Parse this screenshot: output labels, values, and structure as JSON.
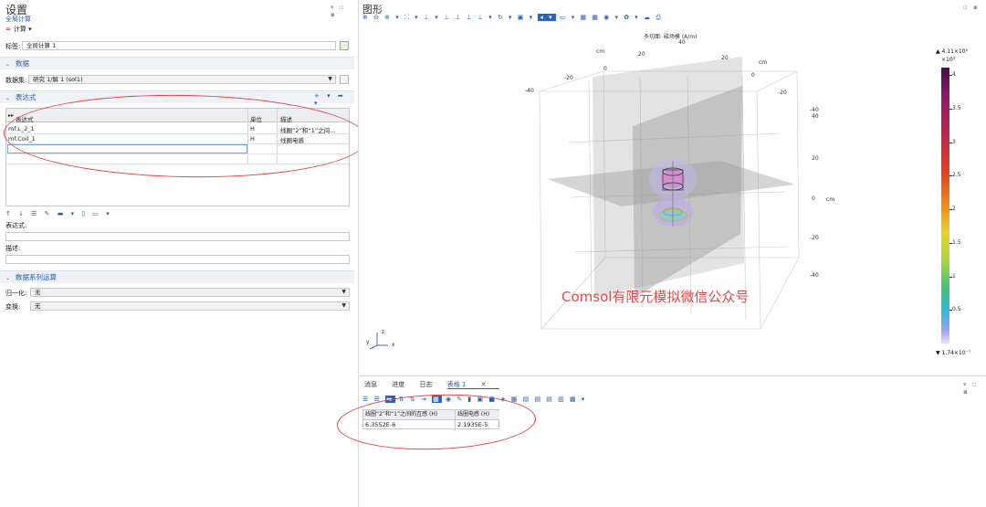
{
  "settings": {
    "title": "设置",
    "subtitle": "全局计算",
    "compute_label": "计算",
    "label_row": {
      "label": "标签:",
      "value": "全局计算 1"
    },
    "data_section": "数据",
    "dataset_row": {
      "label": "数据集:",
      "value": "研究 1/解 1 (sol1)"
    },
    "expr_section": "表达式",
    "table_headers": [
      "表达式",
      "单位",
      "描述"
    ],
    "table_rows": [
      {
        "expr": "mf.L_2_1",
        "unit": "H",
        "desc": "线圈“2”和“1”之间..."
      },
      {
        "expr": "mf.Coil_1",
        "unit": "H",
        "desc": "线圈电感"
      }
    ],
    "expression_label": "表达式:",
    "description_label": "描述:",
    "series_section": "数据系列运算",
    "normalize_row": {
      "label": "归一化:",
      "value": "无"
    },
    "transform_row": {
      "label": "变换:",
      "value": "无"
    }
  },
  "graphics": {
    "title": "图形",
    "plot_title": "多切面: 磁场模 (A/m)",
    "axis_unit": "cm",
    "x_ticks": [
      "-40",
      "-20",
      "0",
      "20",
      "40"
    ],
    "y_ticks": [
      "20",
      "0",
      "-20",
      "-40"
    ],
    "z_ticks": [
      "40",
      "20",
      "0",
      "-20",
      "-40"
    ],
    "colorbar": {
      "max_label": "▲ 4.11×10³",
      "unit_label": "×10³",
      "min_label": "▼ 1.74×10⁻⁷",
      "ticks": [
        "4",
        "3.5",
        "3",
        "2.5",
        "2",
        "1.5",
        "1",
        "0.5"
      ],
      "tick_values": [
        4,
        3.5,
        3,
        2.5,
        2,
        1.5,
        1,
        0.5
      ],
      "range": [
        0,
        4.11
      ]
    },
    "watermark": "Comsol有限元模拟微信公众号",
    "axis_triad": {
      "x": "x",
      "y": "y",
      "z": "z"
    }
  },
  "bottom": {
    "tabs": [
      "消息",
      "进度",
      "日志",
      "表格 1"
    ],
    "result_headers": [
      "线圈“2”和“1”之间的互感 (H)",
      "线圈电感 (H)"
    ],
    "result_values": [
      "6.3552E-6",
      "2.1935E-5"
    ]
  },
  "colors": {
    "accent": "#2a5db0",
    "annotation": "#e04545",
    "section_bg": "#eef1f6"
  }
}
